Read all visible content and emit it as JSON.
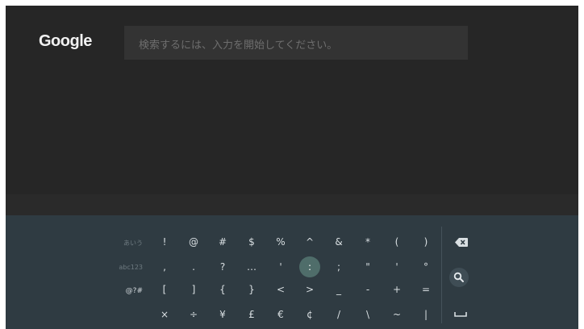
{
  "header": {
    "logo": "Google",
    "search_placeholder": "検索するには、入力を開始してください。"
  },
  "keyboard": {
    "modes": [
      {
        "label": "あいう",
        "active": false
      },
      {
        "label": "abc123",
        "active": false
      },
      {
        "label": "@?#",
        "active": true
      }
    ],
    "rows": [
      [
        "!",
        "@",
        "#",
        "$",
        "%",
        "^",
        "&",
        "*",
        "(",
        ")"
      ],
      [
        ",",
        ".",
        "?",
        "…",
        "'",
        ":",
        ";",
        "\"",
        "'",
        "°"
      ],
      [
        "[",
        "]",
        "{",
        "}",
        "<",
        ">",
        "_",
        "-",
        "+",
        "="
      ],
      [
        "×",
        "÷",
        "¥",
        "£",
        "€",
        "¢",
        "/",
        "\\",
        "~",
        "|"
      ]
    ],
    "focused_key": ":",
    "actions": [
      {
        "icon": "backspace-icon"
      },
      {
        "icon": "search-icon"
      },
      {
        "icon": "space-icon"
      }
    ],
    "colors": {
      "background": "#2f3b42",
      "focus": "#4f6d6a",
      "key_text": "#d9dfe2"
    }
  }
}
